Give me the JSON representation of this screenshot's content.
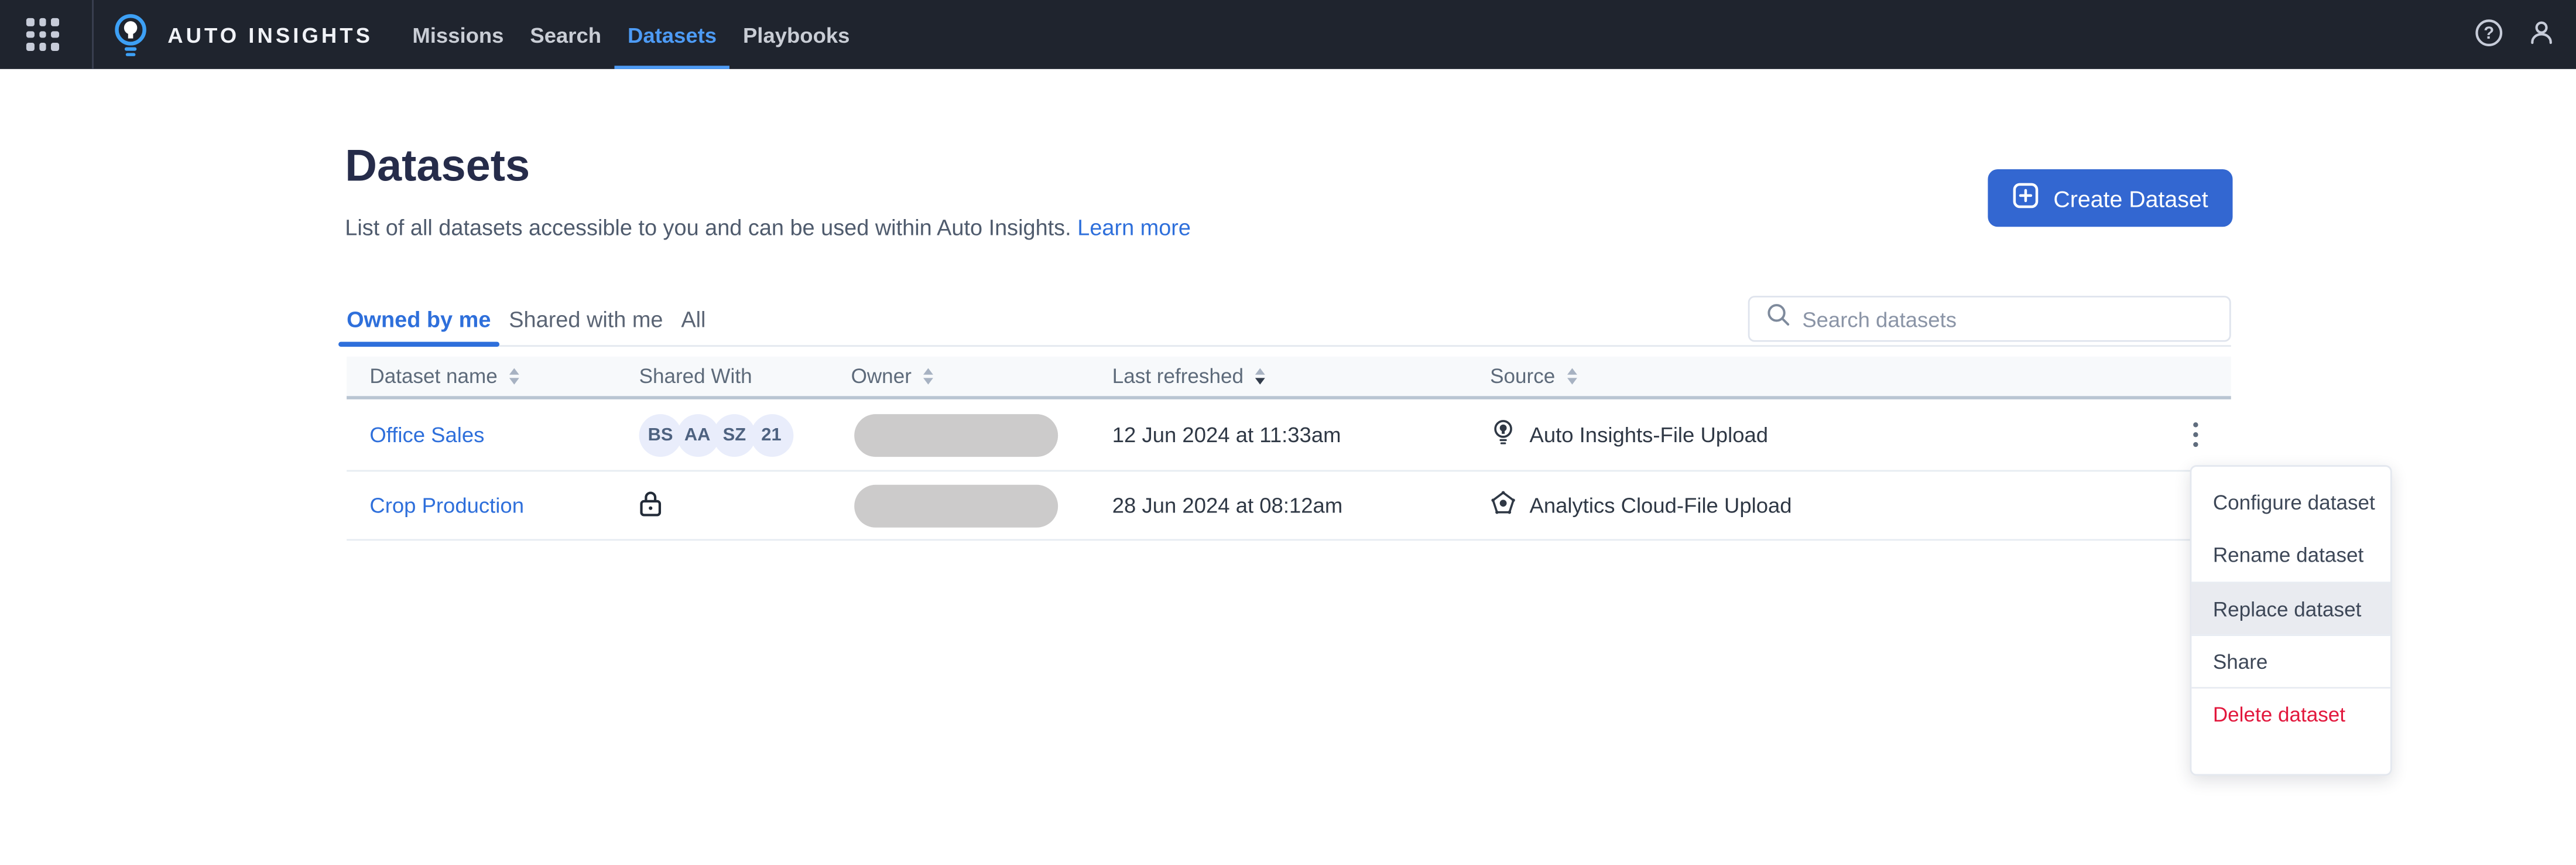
{
  "colors": {
    "navbar_bg": "#1f242e",
    "accent_blue": "#4d9bf5",
    "link_blue": "#2e6fdb",
    "button_blue": "#3367d1",
    "title_navy": "#262c4a",
    "text_dark": "#2f3845",
    "danger_red": "#e2183d",
    "avatar_bg": "#e9edfb",
    "avatar_text": "#4e6280",
    "owner_pill": "#cccbcb",
    "menu_highlight": "#e9ebf0"
  },
  "navbar": {
    "app_name": "AUTO INSIGHTS",
    "items": [
      {
        "label": "Missions",
        "active": false
      },
      {
        "label": "Search",
        "active": false
      },
      {
        "label": "Datasets",
        "active": true
      },
      {
        "label": "Playbooks",
        "active": false
      }
    ],
    "icons": [
      "grid-icon",
      "lightbulb-logo-icon",
      "help-icon",
      "user-icon"
    ]
  },
  "page": {
    "title": "Datasets",
    "description": "List of all datasets accessible to you and can be used within Auto Insights.",
    "learn_more_label": "Learn more",
    "create_button_label": "Create Dataset"
  },
  "tabs": [
    {
      "label": "Owned by me",
      "active": true
    },
    {
      "label": "Shared with me",
      "active": false
    },
    {
      "label": "All",
      "active": false
    }
  ],
  "search": {
    "placeholder": "Search datasets"
  },
  "table": {
    "headers": [
      {
        "label": "Dataset name",
        "sortable": true
      },
      {
        "label": "Shared With",
        "sortable": false
      },
      {
        "label": "Owner",
        "sortable": true
      },
      {
        "label": "Last refreshed",
        "sortable": true,
        "sorted": "desc"
      },
      {
        "label": "Source",
        "sortable": true
      }
    ],
    "rows": [
      {
        "name": "Office Sales",
        "shared_with": {
          "type": "avatars",
          "avatars": [
            "BS",
            "AA",
            "SZ",
            "21"
          ]
        },
        "owner": "(redacted)",
        "last_refreshed": "12 Jun 2024 at 11:33am",
        "source": {
          "icon": "auto-insights-bulb-icon",
          "label": "Auto Insights-File Upload"
        }
      },
      {
        "name": "Crop Production",
        "shared_with": {
          "type": "lock"
        },
        "owner": "(redacted)",
        "last_refreshed": "28 Jun 2024 at 08:12am",
        "source": {
          "icon": "analytics-cloud-icon",
          "label": "Analytics Cloud-File Upload"
        }
      }
    ]
  },
  "context_menu": {
    "items": [
      {
        "label": "Configure dataset",
        "highlighted": false,
        "danger": false
      },
      {
        "label": "Rename dataset",
        "highlighted": false,
        "danger": false
      },
      {
        "label": "Replace dataset",
        "highlighted": true,
        "danger": false
      },
      {
        "label": "Share",
        "highlighted": false,
        "danger": false
      },
      {
        "label": "Delete dataset",
        "highlighted": false,
        "danger": true
      }
    ]
  }
}
